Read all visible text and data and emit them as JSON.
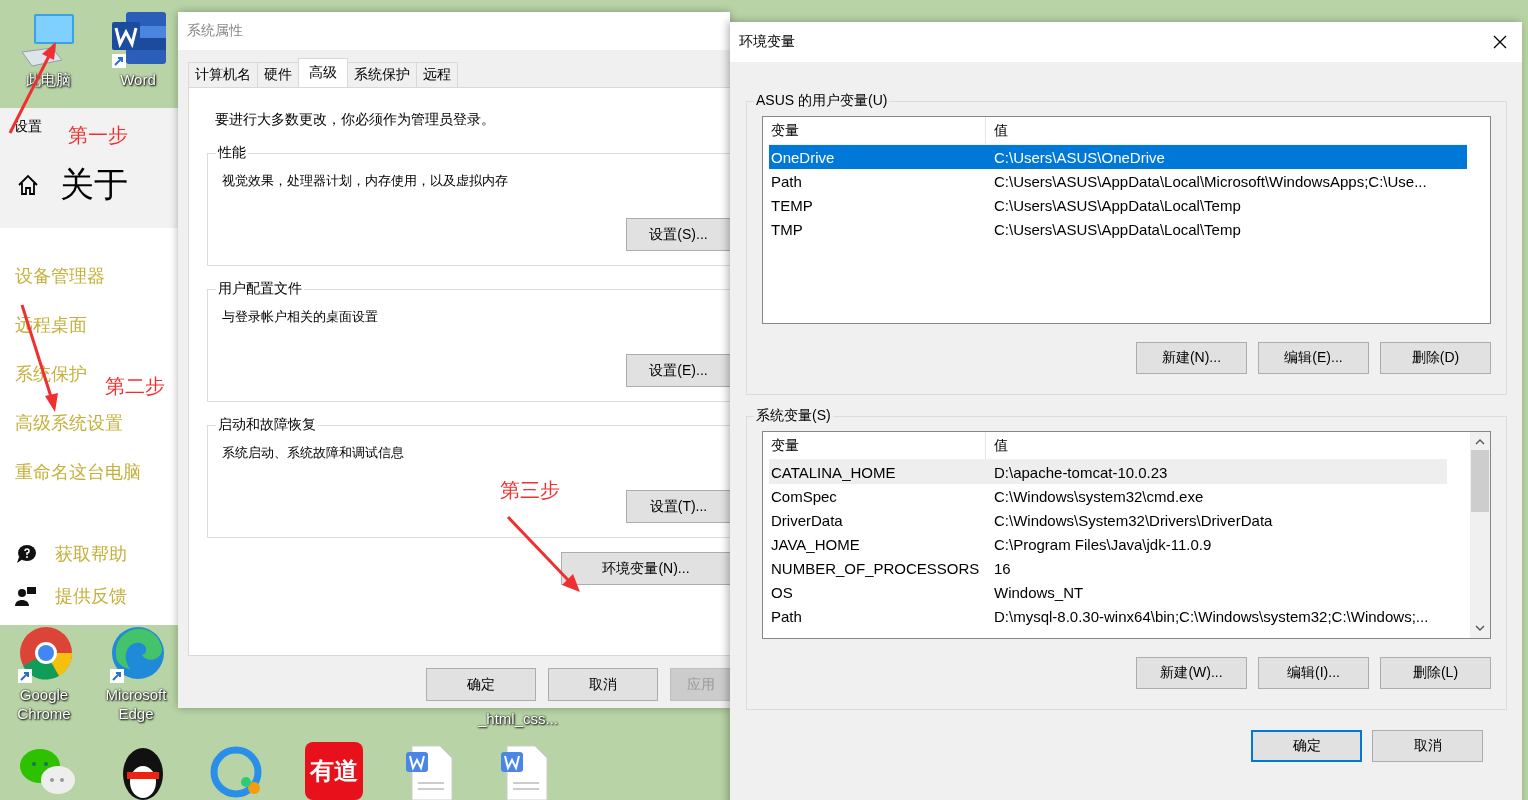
{
  "desktop_icons": [
    {
      "kind": "computer",
      "label": "此电脑"
    },
    {
      "kind": "word",
      "label": "Word"
    },
    {
      "kind": "chrome",
      "label": "Google Chrome"
    },
    {
      "kind": "edge",
      "label": "Microsoft Edge"
    },
    {
      "kind": "hidden",
      "label": "_html_css..."
    },
    {
      "kind": "chat"
    },
    {
      "kind": "penguin"
    },
    {
      "kind": "sync"
    },
    {
      "kind": "youdao",
      "logo_text": "有道"
    },
    {
      "kind": "document"
    },
    {
      "kind": "document"
    }
  ],
  "settings_panel": {
    "title": "设置",
    "heading": "关于",
    "links": [
      "设备管理器",
      "远程桌面",
      "系统保护",
      "高级系统设置",
      "重命名这台电脑"
    ],
    "help": [
      {
        "kind": "help",
        "label": "获取帮助"
      },
      {
        "kind": "feedback",
        "label": "提供反馈"
      }
    ]
  },
  "annotations": [
    "第一步",
    "第二步",
    "第三步"
  ],
  "system_properties": {
    "title": "系统属性",
    "tabs": [
      {
        "label": "计算机名",
        "selected": false
      },
      {
        "label": "硬件",
        "selected": false
      },
      {
        "label": "高级",
        "selected": true
      },
      {
        "label": "系统保护",
        "selected": false
      },
      {
        "label": "远程",
        "selected": false
      }
    ],
    "notice": "要进行大多数更改，你必须作为管理员登录。",
    "groups": [
      {
        "title": "性能",
        "description": "视觉效果，处理器计划，内存使用，以及虚拟内存",
        "button": "设置(S)..."
      },
      {
        "title": "用户配置文件",
        "description": "与登录帐户相关的桌面设置",
        "button": "设置(E)..."
      },
      {
        "title": "启动和故障恢复",
        "description": "系统启动、系统故障和调试信息",
        "button": "设置(T)..."
      }
    ],
    "env_button": "环境变量(N)...",
    "buttons": [
      {
        "label": "确定",
        "disabled": false
      },
      {
        "label": "取消",
        "disabled": false
      },
      {
        "label": "应用",
        "disabled": true
      }
    ]
  },
  "environment_variables": {
    "title": "环境变量",
    "user_vars": {
      "title": "ASUS 的用户变量(U)",
      "columns": [
        "变量",
        "值"
      ],
      "rows": [
        {
          "name": "OneDrive",
          "value": "C:\\Users\\ASUS\\OneDrive",
          "selected": true
        },
        {
          "name": "Path",
          "value": "C:\\Users\\ASUS\\AppData\\Local\\Microsoft\\WindowsApps;C:\\Use...",
          "selected": false
        },
        {
          "name": "TEMP",
          "value": "C:\\Users\\ASUS\\AppData\\Local\\Temp",
          "selected": false
        },
        {
          "name": "TMP",
          "value": "C:\\Users\\ASUS\\AppData\\Local\\Temp",
          "selected": false
        }
      ],
      "buttons": [
        "新建(N)...",
        "编辑(E)...",
        "删除(D)"
      ]
    },
    "system_vars": {
      "title": "系统变量(S)",
      "columns": [
        "变量",
        "值"
      ],
      "rows": [
        {
          "name": "CATALINA_HOME",
          "value": "D:\\apache-tomcat-10.0.23",
          "selected": true
        },
        {
          "name": "ComSpec",
          "value": "C:\\Windows\\system32\\cmd.exe",
          "selected": false
        },
        {
          "name": "DriverData",
          "value": "C:\\Windows\\System32\\Drivers\\DriverData",
          "selected": false
        },
        {
          "name": "JAVA_HOME",
          "value": "C:\\Program Files\\Java\\jdk-11.0.9",
          "selected": false
        },
        {
          "name": "NUMBER_OF_PROCESSORS",
          "value": "16",
          "selected": false
        },
        {
          "name": "OS",
          "value": "Windows_NT",
          "selected": false
        },
        {
          "name": "Path",
          "value": "D:\\mysql-8.0.30-winx64\\bin;C:\\Windows\\system32;C:\\Windows;...",
          "selected": false
        }
      ],
      "buttons": [
        "新建(W)...",
        "编辑(I)...",
        "删除(L)"
      ]
    },
    "buttons": [
      {
        "label": "确定",
        "default": true
      },
      {
        "label": "取消",
        "default": false
      }
    ]
  }
}
